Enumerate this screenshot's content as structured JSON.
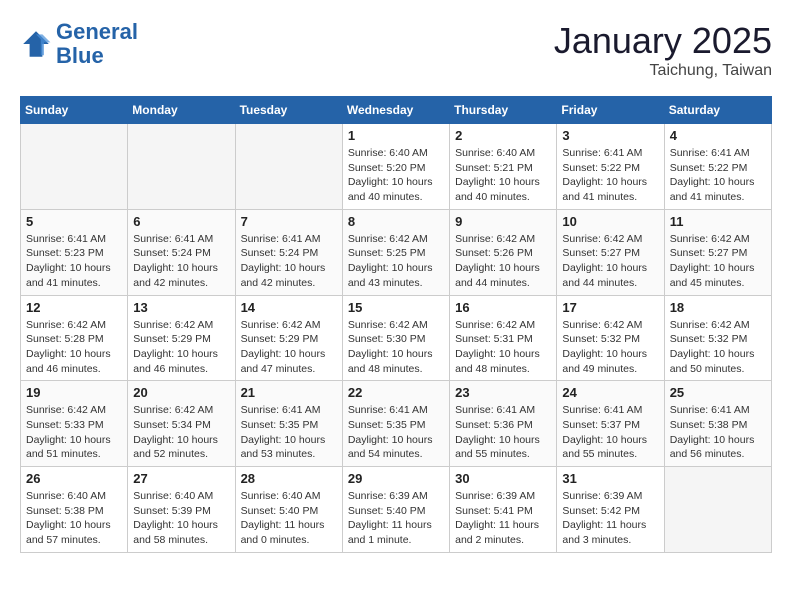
{
  "header": {
    "logo_line1": "General",
    "logo_line2": "Blue",
    "month_title": "January 2025",
    "subtitle": "Taichung, Taiwan"
  },
  "weekdays": [
    "Sunday",
    "Monday",
    "Tuesday",
    "Wednesday",
    "Thursday",
    "Friday",
    "Saturday"
  ],
  "weeks": [
    [
      {
        "day": "",
        "info": ""
      },
      {
        "day": "",
        "info": ""
      },
      {
        "day": "",
        "info": ""
      },
      {
        "day": "1",
        "info": "Sunrise: 6:40 AM\nSunset: 5:20 PM\nDaylight: 10 hours\nand 40 minutes."
      },
      {
        "day": "2",
        "info": "Sunrise: 6:40 AM\nSunset: 5:21 PM\nDaylight: 10 hours\nand 40 minutes."
      },
      {
        "day": "3",
        "info": "Sunrise: 6:41 AM\nSunset: 5:22 PM\nDaylight: 10 hours\nand 41 minutes."
      },
      {
        "day": "4",
        "info": "Sunrise: 6:41 AM\nSunset: 5:22 PM\nDaylight: 10 hours\nand 41 minutes."
      }
    ],
    [
      {
        "day": "5",
        "info": "Sunrise: 6:41 AM\nSunset: 5:23 PM\nDaylight: 10 hours\nand 41 minutes."
      },
      {
        "day": "6",
        "info": "Sunrise: 6:41 AM\nSunset: 5:24 PM\nDaylight: 10 hours\nand 42 minutes."
      },
      {
        "day": "7",
        "info": "Sunrise: 6:41 AM\nSunset: 5:24 PM\nDaylight: 10 hours\nand 42 minutes."
      },
      {
        "day": "8",
        "info": "Sunrise: 6:42 AM\nSunset: 5:25 PM\nDaylight: 10 hours\nand 43 minutes."
      },
      {
        "day": "9",
        "info": "Sunrise: 6:42 AM\nSunset: 5:26 PM\nDaylight: 10 hours\nand 44 minutes."
      },
      {
        "day": "10",
        "info": "Sunrise: 6:42 AM\nSunset: 5:27 PM\nDaylight: 10 hours\nand 44 minutes."
      },
      {
        "day": "11",
        "info": "Sunrise: 6:42 AM\nSunset: 5:27 PM\nDaylight: 10 hours\nand 45 minutes."
      }
    ],
    [
      {
        "day": "12",
        "info": "Sunrise: 6:42 AM\nSunset: 5:28 PM\nDaylight: 10 hours\nand 46 minutes."
      },
      {
        "day": "13",
        "info": "Sunrise: 6:42 AM\nSunset: 5:29 PM\nDaylight: 10 hours\nand 46 minutes."
      },
      {
        "day": "14",
        "info": "Sunrise: 6:42 AM\nSunset: 5:29 PM\nDaylight: 10 hours\nand 47 minutes."
      },
      {
        "day": "15",
        "info": "Sunrise: 6:42 AM\nSunset: 5:30 PM\nDaylight: 10 hours\nand 48 minutes."
      },
      {
        "day": "16",
        "info": "Sunrise: 6:42 AM\nSunset: 5:31 PM\nDaylight: 10 hours\nand 48 minutes."
      },
      {
        "day": "17",
        "info": "Sunrise: 6:42 AM\nSunset: 5:32 PM\nDaylight: 10 hours\nand 49 minutes."
      },
      {
        "day": "18",
        "info": "Sunrise: 6:42 AM\nSunset: 5:32 PM\nDaylight: 10 hours\nand 50 minutes."
      }
    ],
    [
      {
        "day": "19",
        "info": "Sunrise: 6:42 AM\nSunset: 5:33 PM\nDaylight: 10 hours\nand 51 minutes."
      },
      {
        "day": "20",
        "info": "Sunrise: 6:42 AM\nSunset: 5:34 PM\nDaylight: 10 hours\nand 52 minutes."
      },
      {
        "day": "21",
        "info": "Sunrise: 6:41 AM\nSunset: 5:35 PM\nDaylight: 10 hours\nand 53 minutes."
      },
      {
        "day": "22",
        "info": "Sunrise: 6:41 AM\nSunset: 5:35 PM\nDaylight: 10 hours\nand 54 minutes."
      },
      {
        "day": "23",
        "info": "Sunrise: 6:41 AM\nSunset: 5:36 PM\nDaylight: 10 hours\nand 55 minutes."
      },
      {
        "day": "24",
        "info": "Sunrise: 6:41 AM\nSunset: 5:37 PM\nDaylight: 10 hours\nand 55 minutes."
      },
      {
        "day": "25",
        "info": "Sunrise: 6:41 AM\nSunset: 5:38 PM\nDaylight: 10 hours\nand 56 minutes."
      }
    ],
    [
      {
        "day": "26",
        "info": "Sunrise: 6:40 AM\nSunset: 5:38 PM\nDaylight: 10 hours\nand 57 minutes."
      },
      {
        "day": "27",
        "info": "Sunrise: 6:40 AM\nSunset: 5:39 PM\nDaylight: 10 hours\nand 58 minutes."
      },
      {
        "day": "28",
        "info": "Sunrise: 6:40 AM\nSunset: 5:40 PM\nDaylight: 11 hours\nand 0 minutes."
      },
      {
        "day": "29",
        "info": "Sunrise: 6:39 AM\nSunset: 5:40 PM\nDaylight: 11 hours\nand 1 minute."
      },
      {
        "day": "30",
        "info": "Sunrise: 6:39 AM\nSunset: 5:41 PM\nDaylight: 11 hours\nand 2 minutes."
      },
      {
        "day": "31",
        "info": "Sunrise: 6:39 AM\nSunset: 5:42 PM\nDaylight: 11 hours\nand 3 minutes."
      },
      {
        "day": "",
        "info": ""
      }
    ]
  ]
}
